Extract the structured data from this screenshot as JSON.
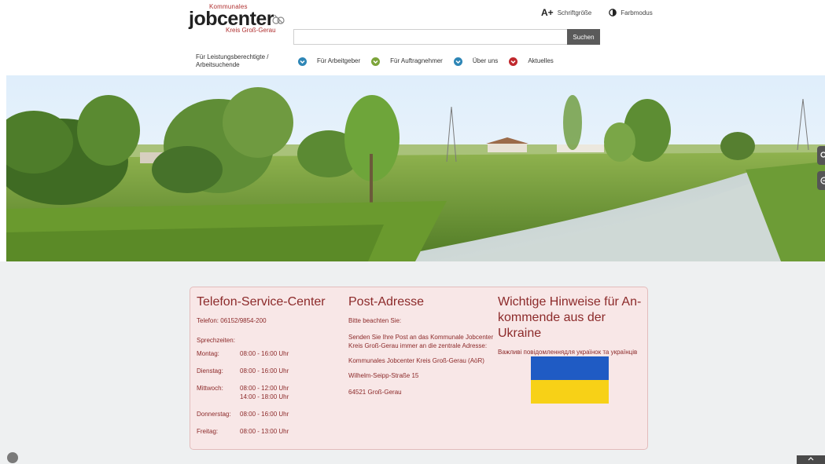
{
  "logo": {
    "small": "Kommunales",
    "main_a": "jobcenter",
    "sub": "Kreis Groß-Gerau"
  },
  "tools": {
    "font_size_icon": "A+",
    "font_size_label": "Schriftgröße",
    "color_mode_label": "Farbmodus"
  },
  "search": {
    "placeholder": "",
    "button_label": "Suchen"
  },
  "nav": {
    "items": [
      {
        "label": "Für Leistungsberechtigte / Arbeitsuchende",
        "chevron_color": "#2e86b6"
      },
      {
        "label": "Für Arbeitgeber",
        "chevron_color": "#7ca43a"
      },
      {
        "label": "Für Auftragnehmer",
        "chevron_color": "#2e86b6"
      },
      {
        "label": "Über uns",
        "chevron_color": "#c0282d"
      },
      {
        "label": "Aktuelles",
        "chevron_color": "#c0282d"
      }
    ]
  },
  "contact": {
    "title": "Telefon-Service-Center",
    "phone": "Telefon: 06152/9854-200",
    "hours_label": "Sprechzeiten:",
    "hours": [
      {
        "day": "Montag:",
        "times": [
          "08:00 - 16:00 Uhr"
        ]
      },
      {
        "day": "Dienstag:",
        "times": [
          "08:00 - 16:00 Uhr"
        ]
      },
      {
        "day": "Mittwoch:",
        "times": [
          "08:00 - 12:00 Uhr",
          "14:00 - 18:00 Uhr"
        ]
      },
      {
        "day": "Donnerstag:",
        "times": [
          "08:00 - 16:00 Uhr"
        ]
      },
      {
        "day": "Freitag:",
        "times": [
          "08:00 - 13:00 Uhr"
        ]
      }
    ]
  },
  "post": {
    "title": "Post-Adresse",
    "note": "Bitte beachten Sie:",
    "text": "Senden Sie Ihre Post an das Kommunale Jobcenter Kreis Groß-Gerau immer an die zentrale Adresse:",
    "org": "Kommunales Jobcenter Kreis Groß-Gerau (AöR)",
    "street": "Wilhelm-Seipp-Straße 15",
    "city": "64521 Groß-Gerau"
  },
  "ukraine": {
    "title": "Wichtige Hinweise für An-kommende aus der Ukraine",
    "text": "Важливі повідомленнядля українок та українців",
    "flag_blue": "#1f5bc4",
    "flag_yellow": "#f7d117"
  },
  "colors": {
    "accent": "#c0282d",
    "card_bg": "#f8e7e7",
    "card_text": "#8c2a2a",
    "search_button": "#5a5a5a"
  }
}
